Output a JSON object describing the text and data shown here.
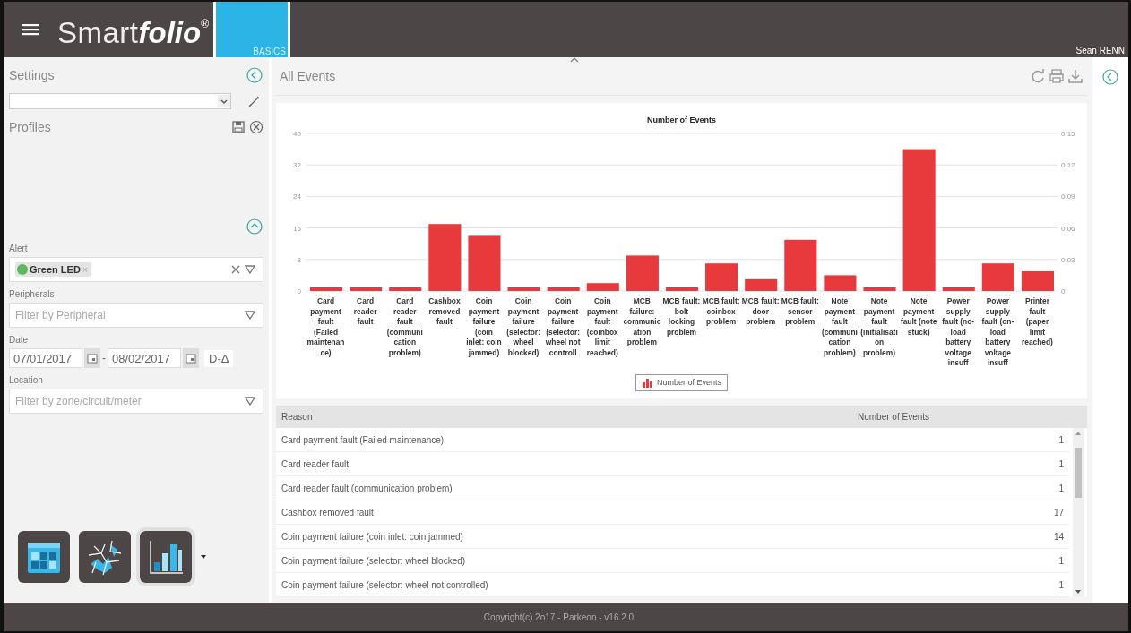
{
  "header": {
    "logo": {
      "light": "Smart",
      "bold": "folio",
      "mark": "®"
    },
    "edition": "BASICS",
    "user": "Sean RENN"
  },
  "sidebar": {
    "title": "Settings",
    "profiles_label": "Profiles",
    "filters": [
      {
        "kind": "tags",
        "label": "Alert",
        "tags": [
          {
            "label": "Green LED",
            "remove": "×"
          }
        ]
      },
      {
        "kind": "select",
        "label": "Peripherals",
        "placeholder": "Filter by Peripheral"
      },
      {
        "kind": "dates",
        "label": "Date",
        "from": "07/01/2017",
        "separator": "-",
        "to": "08/02/2017",
        "delta": "D-Δ"
      },
      {
        "kind": "select",
        "label": "Location",
        "placeholder": "Filter by zone/circuit/meter"
      }
    ],
    "views": [
      {
        "kind": "grid",
        "selected": false
      },
      {
        "kind": "map",
        "selected": false
      },
      {
        "kind": "chart",
        "selected": true
      }
    ]
  },
  "main": {
    "title": "All Events",
    "chart": {
      "chart_data": {
        "type": "bar",
        "title": "Number of Events",
        "categories": [
          "Card payment fault (Failed maintenance)",
          "Card reader fault",
          "Card reader fault (communication problem)",
          "Cashbox removed fault",
          "Coin payment failure (coin inlet: coin jammed)",
          "Coin payment failure (selector: wheel blocked)",
          "Coin payment failure (selector: wheel not controll",
          "Coin payment fault (coinbox limit reached)",
          "MCB failure: communication problem",
          "MCB fault: bolt locking problem",
          "MCB fault: coinbox problem",
          "MCB fault: door problem",
          "MCB fault: sensor problem",
          "Note payment fault (communication problem)",
          "Note payment fault (initialisation problem)",
          "Note payment fault (note stuck)",
          "Power supply fault (no-load battery voltage insuff",
          "Power supply fault (on-load battery voltage insuff",
          "Printer fault (paper limit reached)"
        ],
        "series": [
          {
            "name": "Number of Events",
            "color": "#e8393c",
            "values": [
              1,
              1,
              1,
              17,
              14,
              1,
              1,
              2,
              9,
              1,
              7,
              3,
              13,
              4,
              1,
              36,
              1,
              7,
              5
            ]
          }
        ],
        "ylim": [
          0,
          40
        ],
        "yticks": [
          0,
          8,
          16,
          24,
          32,
          40
        ],
        "grid": true
      },
      "right_axis_ticks": [
        "0.15",
        "0.12",
        "0.09",
        "0.06",
        "0.03",
        "0"
      ]
    },
    "table": {
      "columns": [
        "Reason",
        "Number of Events"
      ],
      "rows": [
        [
          "Card payment fault (Failed maintenance)",
          "1"
        ],
        [
          "Card reader fault",
          "1"
        ],
        [
          "Card reader fault (communication problem)",
          "1"
        ],
        [
          "Cashbox removed fault",
          "17"
        ],
        [
          "Coin payment failure (coin inlet: coin jammed)",
          "14"
        ],
        [
          "Coin payment failure (selector: wheel blocked)",
          "1"
        ],
        [
          "Coin payment failure (selector: wheel not controlled)",
          "1"
        ]
      ]
    }
  },
  "footer": "Copyright(c) 2o17 - Parkeon - v16.2.0"
}
